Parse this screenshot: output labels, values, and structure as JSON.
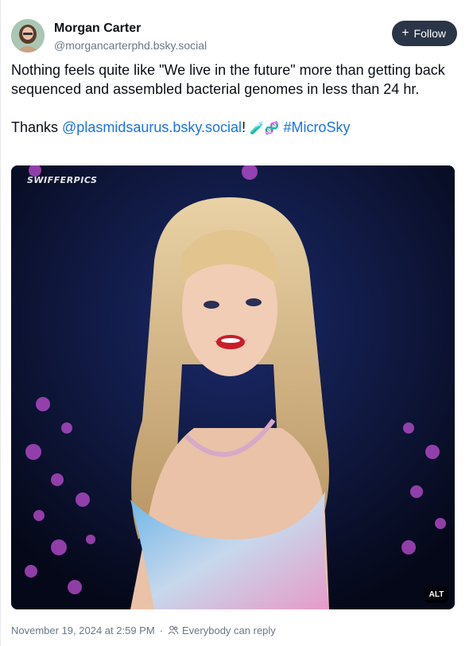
{
  "author": {
    "display_name": "Morgan Carter",
    "handle": "@morgancarterphd.bsky.social"
  },
  "follow_button": {
    "label": "Follow",
    "icon": "plus-icon"
  },
  "post": {
    "paragraph1": "Nothing feels quite like \"We live in the future\" more than getting back sequenced and assembled bacterial genomes in less than 24 hr.",
    "thanks_prefix": "Thanks ",
    "mention": "@plasmidsaurus.bsky.social",
    "exclamation": "!",
    "emojis": "🧪🧬",
    "hashtag": "#MicroSky"
  },
  "media": {
    "watermark": "SWIFFERPICS",
    "alt_label": "ALT"
  },
  "footer": {
    "timestamp": "November 19, 2024 at 2:59 PM",
    "separator": "·",
    "reply_setting": "Everybody can reply"
  },
  "colors": {
    "link": "#1a73e8",
    "follow_bg": "#2a3647",
    "muted": "#6b7785"
  }
}
